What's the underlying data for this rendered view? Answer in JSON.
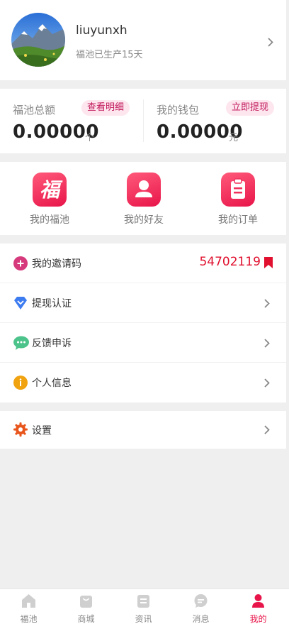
{
  "profile": {
    "username": "liuyunxh",
    "subtitle": "福池已生产15天"
  },
  "balance": {
    "pool": {
      "label": "福池总额",
      "badge": "查看明细",
      "value": "0.00000",
      "unit": "个"
    },
    "wallet": {
      "label": "我的钱包",
      "badge": "立即提现",
      "value": "0.00000",
      "unit": "元"
    }
  },
  "grid": [
    {
      "label": "我的福池",
      "icon": "fu-icon"
    },
    {
      "label": "我的好友",
      "icon": "user-icon"
    },
    {
      "label": "我的订单",
      "icon": "clipboard-icon"
    }
  ],
  "menu": {
    "invite": {
      "label": "我的邀请码",
      "code": "54702119",
      "icon": "plus-icon"
    },
    "withdraw_auth": {
      "label": "提现认证",
      "icon": "diamond-icon"
    },
    "feedback": {
      "label": "反馈申诉",
      "icon": "chat-bubble-icon"
    },
    "personal": {
      "label": "个人信息",
      "icon": "info-icon"
    }
  },
  "settings": {
    "label": "设置",
    "icon": "gear-icon"
  },
  "tabbar": [
    {
      "label": "福池",
      "icon": "home-icon",
      "active": false
    },
    {
      "label": "商城",
      "icon": "shop-bag-icon",
      "active": false
    },
    {
      "label": "资讯",
      "icon": "news-icon",
      "active": false
    },
    {
      "label": "消息",
      "icon": "message-icon",
      "active": false
    },
    {
      "label": "我的",
      "icon": "person-icon",
      "active": true
    }
  ],
  "colors": {
    "accent": "#e8154a",
    "invite_code": "#e0102e",
    "badge_bg": "#fde6ee",
    "badge_text": "#c2185b"
  }
}
